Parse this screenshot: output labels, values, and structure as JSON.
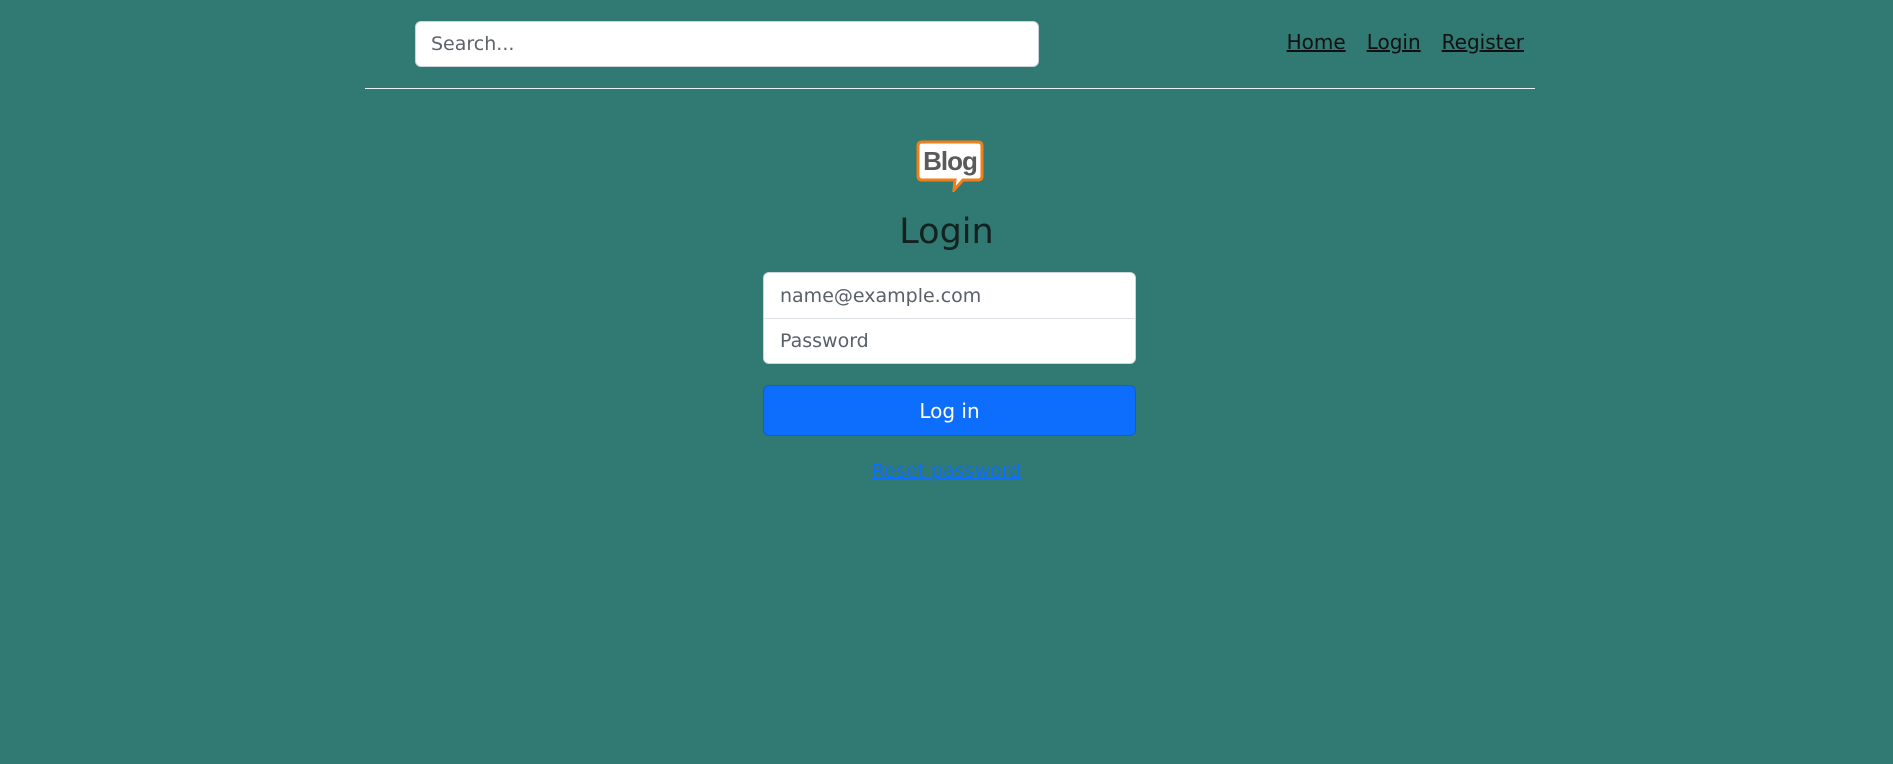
{
  "header": {
    "search": {
      "placeholder": "Search...",
      "value": ""
    },
    "nav": [
      {
        "label": "Home"
      },
      {
        "label": "Login"
      },
      {
        "label": "Register"
      }
    ]
  },
  "logo": {
    "text": "Blog",
    "icon": "blog-speech-bubble-logo",
    "border_color": "#f07f1b",
    "text_color": "#5a5a5a"
  },
  "login": {
    "title": "Login",
    "email": {
      "placeholder": "name@example.com",
      "value": ""
    },
    "password": {
      "placeholder": "Password",
      "value": ""
    },
    "submit_label": "Log in",
    "reset_label": "Reset password"
  },
  "colors": {
    "background": "#317973",
    "primary": "#0d6efd"
  }
}
